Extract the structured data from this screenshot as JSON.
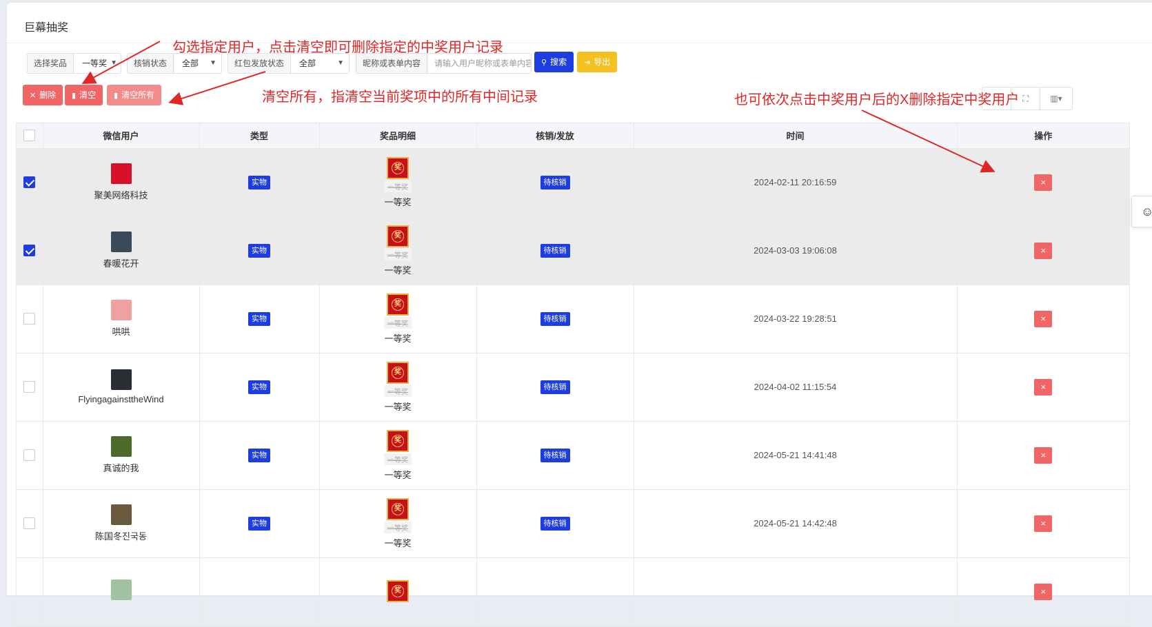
{
  "page": {
    "title": "巨幕抽奖"
  },
  "filters": {
    "prize": {
      "label": "选择奖品",
      "value": "一等奖"
    },
    "verify_status": {
      "label": "核销状态",
      "value": "全部"
    },
    "redpacket_status": {
      "label": "红包发放状态",
      "value": "全部"
    },
    "keyword": {
      "label": "昵称或表单内容",
      "placeholder": "请输入用户昵称或表单内容"
    },
    "search_label": "搜索",
    "export_label": "导出"
  },
  "actions": {
    "delete_label": "删除",
    "clear_label": "清空",
    "clear_all_label": "清空所有"
  },
  "table": {
    "headers": [
      "微信用户",
      "类型",
      "奖品明细",
      "核销/发放",
      "时间",
      "操作"
    ],
    "rows": [
      {
        "checked": true,
        "user": "聚美网络科技",
        "type": "实物",
        "prize_sub": "一等奖",
        "prize": "一等奖",
        "status": "待核销",
        "time": "2024-02-11 20:16:59",
        "avatar_color": "#d8102a"
      },
      {
        "checked": true,
        "user": "春暖花开",
        "type": "实物",
        "prize_sub": "一等奖",
        "prize": "一等奖",
        "status": "待核销",
        "time": "2024-03-03 19:06:08",
        "avatar_color": "#3a4a5a"
      },
      {
        "checked": false,
        "user": "哄哄",
        "type": "实物",
        "prize_sub": "一等奖",
        "prize": "一等奖",
        "status": "待核销",
        "time": "2024-03-22 19:28:51",
        "avatar_color": "#f0a0a0"
      },
      {
        "checked": false,
        "user": "FlyingagainsttheWind",
        "type": "实物",
        "prize_sub": "一等奖",
        "prize": "一等奖",
        "status": "待核销",
        "time": "2024-04-02 11:15:54",
        "avatar_color": "#2a2e35"
      },
      {
        "checked": false,
        "user": "真诚的我",
        "type": "实物",
        "prize_sub": "一等奖",
        "prize": "一等奖",
        "status": "待核销",
        "time": "2024-05-21 14:41:48",
        "avatar_color": "#4d6b2a"
      },
      {
        "checked": false,
        "user": "陈国冬진국동",
        "type": "实物",
        "prize_sub": "一等奖",
        "prize": "一等奖",
        "status": "待核销",
        "time": "2024-05-21 14:42:48",
        "avatar_color": "#6a5a40"
      },
      {
        "checked": false,
        "user": "",
        "type": "",
        "prize_sub": "",
        "prize": "",
        "status": "",
        "time": "",
        "avatar_color": "#9fc2a0"
      }
    ],
    "delete_symbol": "×",
    "prize_glyph": "奖"
  },
  "annotations": {
    "note1": "勾选指定用户，点击清空即可删除指定的中奖用户记录",
    "note2": "清空所有，指清空当前奖项中的所有中间记录",
    "note3": "也可依次点击中奖用户后的X删除指定中奖用户"
  },
  "icons": {
    "search": "search-icon",
    "export": "export-icon",
    "delete": "close-icon",
    "clear": "trash-icon",
    "fullscreen": "fullscreen-icon",
    "columns": "columns-icon",
    "float": "qq-icon"
  },
  "colors": {
    "primary": "#1d3de0",
    "danger": "#f06565",
    "warning": "#f5c022",
    "annotation": "#e02626"
  }
}
